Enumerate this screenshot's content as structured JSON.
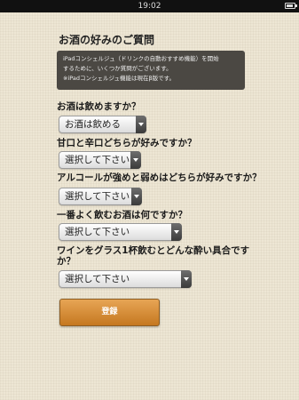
{
  "status_bar": {
    "time": "19:02"
  },
  "page": {
    "title": "お酒の好みのご質問",
    "info_lines": [
      "iPadコンシェルジュ（ドリンクの自動おすすめ機能）を開始",
      "するために、いくつか質問がございます。",
      "※iPadコンシェルジュ機能は現在β版です。"
    ]
  },
  "questions": [
    {
      "label": "お酒は飲めますか？",
      "selected": "お酒は飲める"
    },
    {
      "label": "甘口と辛口どちらが好みですか？",
      "selected": "選択して下さい"
    },
    {
      "label": "アルコールが強めと弱めはどちらが好みですか？",
      "selected": "選択して下さい"
    },
    {
      "label": "一番よく飲むお酒は何ですか？",
      "selected": "選択して下さい"
    },
    {
      "label_lines": [
        "ワインをグラス1杯飲むとどんな酔い具合です",
        "か？"
      ],
      "selected": "選択して下さい"
    }
  ],
  "submit_label": "登録"
}
